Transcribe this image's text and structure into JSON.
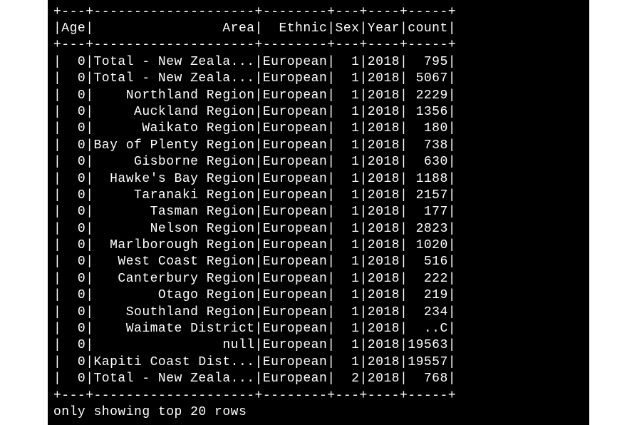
{
  "columns": [
    {
      "name": "Age",
      "width": 3,
      "align": "right"
    },
    {
      "name": "Area",
      "width": 20,
      "align": "right"
    },
    {
      "name": "Ethnic",
      "width": 8,
      "align": "right"
    },
    {
      "name": "Sex",
      "width": 3,
      "align": "right"
    },
    {
      "name": "Year",
      "width": 4,
      "align": "right"
    },
    {
      "name": "count",
      "width": 5,
      "align": "right"
    }
  ],
  "rows": [
    {
      "Age": "0",
      "Area": "Total - New Zeala...",
      "Ethnic": "European",
      "Sex": "1",
      "Year": "2018",
      "count": "795"
    },
    {
      "Age": "0",
      "Area": "Total - New Zeala...",
      "Ethnic": "European",
      "Sex": "1",
      "Year": "2018",
      "count": "5067"
    },
    {
      "Age": "0",
      "Area": "Northland Region",
      "Ethnic": "European",
      "Sex": "1",
      "Year": "2018",
      "count": "2229"
    },
    {
      "Age": "0",
      "Area": "Auckland Region",
      "Ethnic": "European",
      "Sex": "1",
      "Year": "2018",
      "count": "1356"
    },
    {
      "Age": "0",
      "Area": "Waikato Region",
      "Ethnic": "European",
      "Sex": "1",
      "Year": "2018",
      "count": "180"
    },
    {
      "Age": "0",
      "Area": "Bay of Plenty Region",
      "Ethnic": "European",
      "Sex": "1",
      "Year": "2018",
      "count": "738"
    },
    {
      "Age": "0",
      "Area": "Gisborne Region",
      "Ethnic": "European",
      "Sex": "1",
      "Year": "2018",
      "count": "630"
    },
    {
      "Age": "0",
      "Area": "Hawke's Bay Region",
      "Ethnic": "European",
      "Sex": "1",
      "Year": "2018",
      "count": "1188"
    },
    {
      "Age": "0",
      "Area": "Taranaki Region",
      "Ethnic": "European",
      "Sex": "1",
      "Year": "2018",
      "count": "2157"
    },
    {
      "Age": "0",
      "Area": "Tasman Region",
      "Ethnic": "European",
      "Sex": "1",
      "Year": "2018",
      "count": "177"
    },
    {
      "Age": "0",
      "Area": "Nelson Region",
      "Ethnic": "European",
      "Sex": "1",
      "Year": "2018",
      "count": "2823"
    },
    {
      "Age": "0",
      "Area": "Marlborough Region",
      "Ethnic": "European",
      "Sex": "1",
      "Year": "2018",
      "count": "1020"
    },
    {
      "Age": "0",
      "Area": "West Coast Region",
      "Ethnic": "European",
      "Sex": "1",
      "Year": "2018",
      "count": "516"
    },
    {
      "Age": "0",
      "Area": "Canterbury Region",
      "Ethnic": "European",
      "Sex": "1",
      "Year": "2018",
      "count": "222"
    },
    {
      "Age": "0",
      "Area": "Otago Region",
      "Ethnic": "European",
      "Sex": "1",
      "Year": "2018",
      "count": "219"
    },
    {
      "Age": "0",
      "Area": "Southland Region",
      "Ethnic": "European",
      "Sex": "1",
      "Year": "2018",
      "count": "234"
    },
    {
      "Age": "0",
      "Area": "Waimate District",
      "Ethnic": "European",
      "Sex": "1",
      "Year": "2018",
      "count": "..C"
    },
    {
      "Age": "0",
      "Area": "null",
      "Ethnic": "European",
      "Sex": "1",
      "Year": "2018",
      "count": "19563"
    },
    {
      "Age": "0",
      "Area": "Kapiti Coast Dist...",
      "Ethnic": "European",
      "Sex": "1",
      "Year": "2018",
      "count": "19557"
    },
    {
      "Age": "0",
      "Area": "Total - New Zeala...",
      "Ethnic": "European",
      "Sex": "2",
      "Year": "2018",
      "count": "768"
    }
  ],
  "footer": "only showing top 20 rows"
}
